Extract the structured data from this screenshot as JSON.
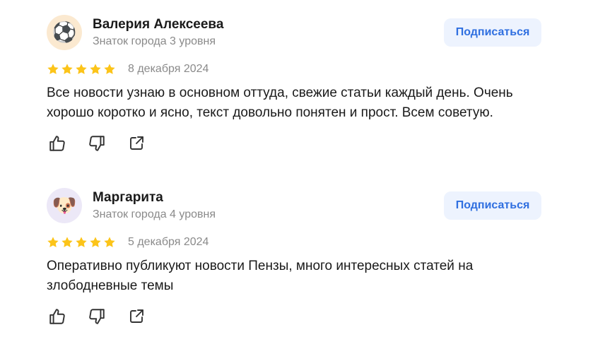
{
  "reviews": [
    {
      "avatar_emoji": "⚽",
      "avatar_bg": "#fbe9d0",
      "author": "Валерия Алексеева",
      "badge": "Знаток города 3 уровня",
      "subscribe_label": "Подписаться",
      "rating": 5,
      "date": "8 декабря 2024",
      "text": "Все новости узнаю в основном оттуда, свежие статьи каждый день. Очень хорошо коротко и ясно, текст довольно понятен и прост. Всем советую."
    },
    {
      "avatar_emoji": "🐶",
      "avatar_bg": "#ece8f7",
      "author": "Маргарита",
      "badge": "Знаток города 4 уровня",
      "subscribe_label": "Подписаться",
      "rating": 5,
      "date": "5 декабря 2024",
      "text": "Оперативно публикуют новости Пензы, много интересных статей на злободневные темы"
    }
  ],
  "icons": {
    "star": "star-icon",
    "like": "thumbs-up-icon",
    "dislike": "thumbs-down-icon",
    "share": "share-icon"
  },
  "colors": {
    "star": "#fcc419",
    "accent": "#2f6fe0",
    "button_bg": "#edf3fe",
    "muted_text": "#8a8a8a"
  }
}
